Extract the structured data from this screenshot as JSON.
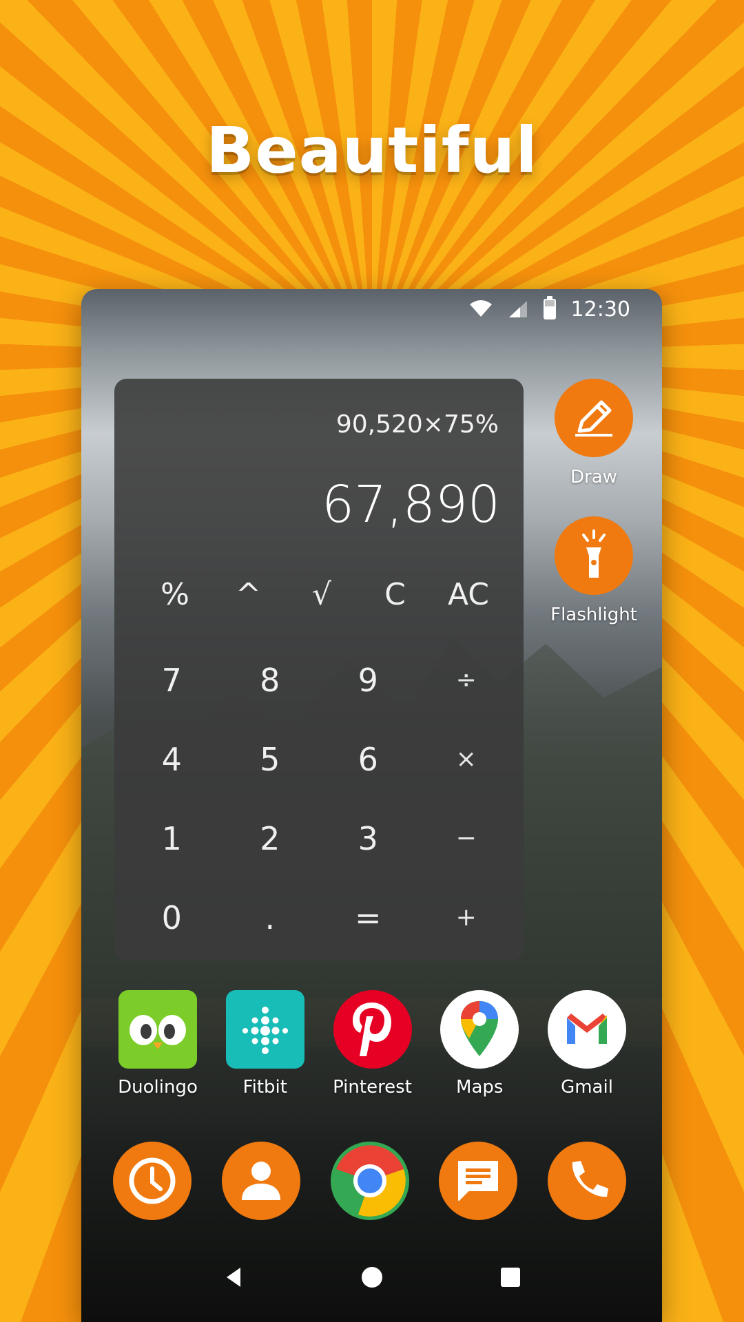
{
  "headline": "Beautiful",
  "status_bar": {
    "time": "12:30",
    "icons": [
      "wifi-icon",
      "signal-icon",
      "battery-icon"
    ]
  },
  "calculator": {
    "expression": "90,520×75%",
    "result": "67,890",
    "function_keys": [
      "%",
      "^",
      "√",
      "C",
      "AC"
    ],
    "keys": [
      "7",
      "8",
      "9",
      "÷",
      "4",
      "5",
      "6",
      "×",
      "1",
      "2",
      "3",
      "−",
      "0",
      ".",
      "=",
      "+"
    ]
  },
  "shortcuts": [
    {
      "label": "Draw",
      "icon": "pencil-icon"
    },
    {
      "label": "Flashlight",
      "icon": "flashlight-icon"
    }
  ],
  "apps": [
    {
      "label": "Duolingo",
      "icon": "duolingo-icon"
    },
    {
      "label": "Fitbit",
      "icon": "fitbit-icon"
    },
    {
      "label": "Pinterest",
      "icon": "pinterest-icon"
    },
    {
      "label": "Maps",
      "icon": "maps-icon"
    },
    {
      "label": "Gmail",
      "icon": "gmail-icon"
    }
  ],
  "dock": [
    "clock-icon",
    "contacts-icon",
    "chrome-icon",
    "messages-icon",
    "phone-icon"
  ],
  "nav": [
    "back-icon",
    "home-icon",
    "recents-icon"
  ],
  "colors": {
    "accent_orange": "#f07a10",
    "background_stripe_light": "#fbb217",
    "background_stripe_dark": "#f5900c",
    "calculator_panel": "#3a3a3a"
  }
}
